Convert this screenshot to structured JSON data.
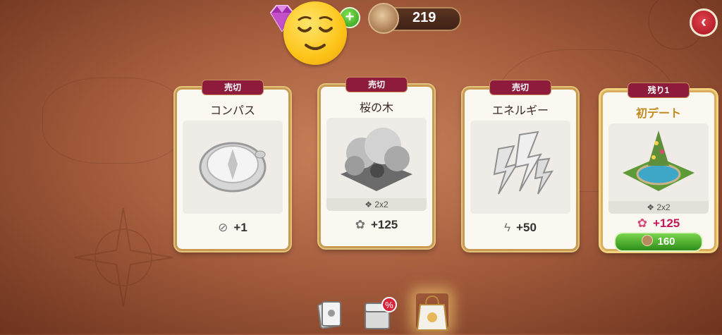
{
  "currency": {
    "gem_icon": "gem-icon",
    "coin_value": "219"
  },
  "emoji": "😌",
  "cards": [
    {
      "badge": "売切",
      "title": "コンパス",
      "size": "",
      "reward_icon": "compass-icon",
      "reward": "+1",
      "price": ""
    },
    {
      "badge": "売切",
      "title": "桜の木",
      "size": "2x2",
      "reward_icon": "blossom-icon",
      "reward": "+125",
      "price": ""
    },
    {
      "badge": "売切",
      "title": "エネルギー",
      "size": "",
      "reward_icon": "bolt-icon",
      "reward": "+50",
      "price": ""
    },
    {
      "badge": "残り1",
      "title": "初デート",
      "size": "2x2",
      "reward_icon": "blossom-icon",
      "reward": "+125",
      "price": "160"
    }
  ],
  "tabs": [
    {
      "name": "decorations-tab",
      "active": false
    },
    {
      "name": "sale-tab",
      "active": false,
      "badge": "%"
    },
    {
      "name": "bag-tab",
      "active": true
    }
  ],
  "colors": {
    "sold_ribbon": "#8e1b3b",
    "buy_button": "#3fa92a",
    "back_button": "#c81f2b"
  }
}
